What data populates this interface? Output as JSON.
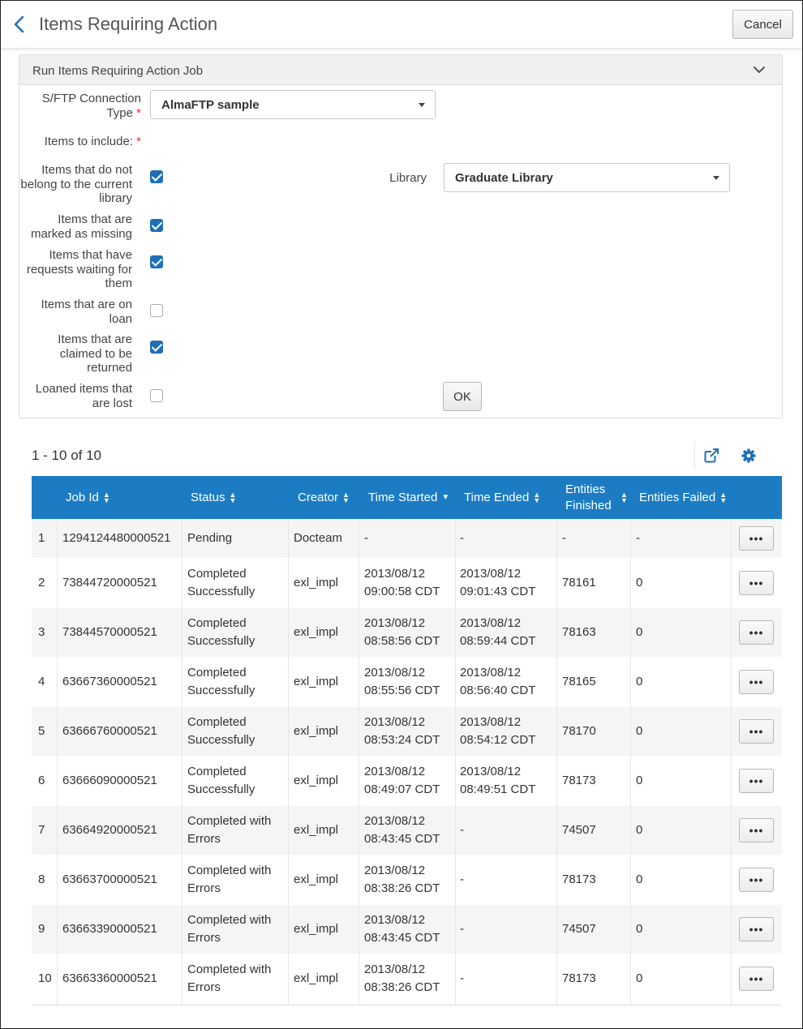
{
  "header": {
    "title": "Items Requiring Action",
    "cancel_label": "Cancel"
  },
  "panel": {
    "title": "Run Items Requiring Action Job",
    "connection_label": "S/FTP Connection Type",
    "connection_value": "AlmaFTP sample",
    "include_label": "Items to include:",
    "required_mark": "*",
    "options": [
      {
        "label": "Items that do not belong to the current library",
        "checked": true
      },
      {
        "label": "Items that are marked as missing",
        "checked": true
      },
      {
        "label": "Items that have requests waiting for them",
        "checked": true
      },
      {
        "label": "Items that are on loan",
        "checked": false
      },
      {
        "label": "Items that are claimed to be returned",
        "checked": true
      },
      {
        "label": "Loaned items that are lost",
        "checked": false
      }
    ],
    "library_label": "Library",
    "library_value": "Graduate Library",
    "ok_label": "OK"
  },
  "results": {
    "count": "1 - 10 of 10"
  },
  "table": {
    "columns": [
      "Job Id",
      "Status",
      "Creator",
      "Time Started",
      "Time Ended",
      "Entities Finished",
      "Entities Failed"
    ],
    "more_label": "•••",
    "rows": [
      {
        "num": "1",
        "job_id": "1294124480000521",
        "status": "Pending",
        "creator": "Docteam",
        "started": "-",
        "ended": "-",
        "finished": "-",
        "failed": "-"
      },
      {
        "num": "2",
        "job_id": "73844720000521",
        "status": "Completed Successfully",
        "creator": "exl_impl",
        "started": "2013/08/12 09:00:58 CDT",
        "ended": "2013/08/12 09:01:43 CDT",
        "finished": "78161",
        "failed": "0"
      },
      {
        "num": "3",
        "job_id": "73844570000521",
        "status": "Completed Successfully",
        "creator": "exl_impl",
        "started": "2013/08/12 08:58:56 CDT",
        "ended": "2013/08/12 08:59:44 CDT",
        "finished": "78163",
        "failed": "0"
      },
      {
        "num": "4",
        "job_id": "63667360000521",
        "status": "Completed Successfully",
        "creator": "exl_impl",
        "started": "2013/08/12 08:55:56 CDT",
        "ended": "2013/08/12 08:56:40 CDT",
        "finished": "78165",
        "failed": "0"
      },
      {
        "num": "5",
        "job_id": "63666760000521",
        "status": "Completed Successfully",
        "creator": "exl_impl",
        "started": "2013/08/12 08:53:24 CDT",
        "ended": "2013/08/12 08:54:12 CDT",
        "finished": "78170",
        "failed": "0"
      },
      {
        "num": "6",
        "job_id": "63666090000521",
        "status": "Completed Successfully",
        "creator": "exl_impl",
        "started": "2013/08/12 08:49:07 CDT",
        "ended": "2013/08/12 08:49:51 CDT",
        "finished": "78173",
        "failed": "0"
      },
      {
        "num": "7",
        "job_id": "63664920000521",
        "status": "Completed with Errors",
        "creator": "exl_impl",
        "started": "2013/08/12 08:43:45 CDT",
        "ended": "-",
        "finished": "74507",
        "failed": "0"
      },
      {
        "num": "8",
        "job_id": "63663700000521",
        "status": "Completed with Errors",
        "creator": "exl_impl",
        "started": "2013/08/12 08:38:26 CDT",
        "ended": "-",
        "finished": "78173",
        "failed": "0"
      },
      {
        "num": "9",
        "job_id": "63663390000521",
        "status": "Completed with Errors",
        "creator": "exl_impl",
        "started": "2013/08/12 08:43:45 CDT",
        "ended": "-",
        "finished": "74507",
        "failed": "0"
      },
      {
        "num": "10",
        "job_id": "63663360000521",
        "status": "Completed with Errors",
        "creator": "exl_impl",
        "started": "2013/08/12 08:38:26 CDT",
        "ended": "-",
        "finished": "78173",
        "failed": "0"
      }
    ]
  }
}
